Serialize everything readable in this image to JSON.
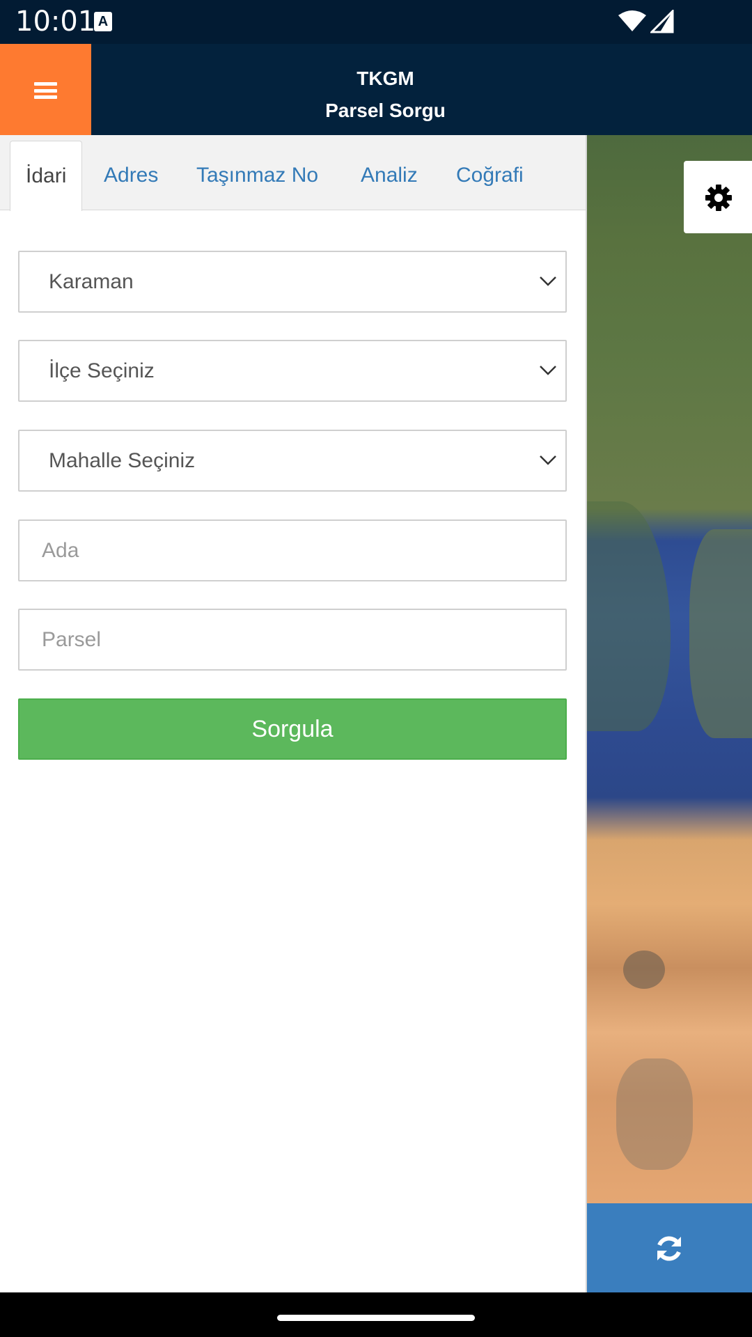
{
  "status_bar": {
    "time": "10:01",
    "notification_icon": "a-icon",
    "wifi_icon": "wifi-icon",
    "signal_icon": "cell-signal-icon"
  },
  "header": {
    "menu_icon": "hamburger-menu-icon",
    "title": "TKGM",
    "subtitle": "Parsel Sorgu",
    "accent_color": "#fe7a30",
    "background_color": "#03223d"
  },
  "tabs": [
    {
      "label": "İdari",
      "active": true
    },
    {
      "label": "Adres",
      "active": false
    },
    {
      "label": "Taşınmaz No",
      "active": false
    },
    {
      "label": "Analiz",
      "active": false
    },
    {
      "label": "Coğrafi",
      "active": false
    }
  ],
  "form": {
    "province_select": {
      "value": "Karaman"
    },
    "district_select": {
      "value": "İlçe Seçiniz"
    },
    "neighborhood_select": {
      "value": "Mahalle Seçiniz"
    },
    "block_input": {
      "placeholder": "Ada",
      "value": ""
    },
    "parcel_input": {
      "placeholder": "Parsel",
      "value": ""
    },
    "submit_label": "Sorgula",
    "submit_color": "#5cb85c"
  },
  "map": {
    "settings_icon": "gear-icon",
    "refresh_icon": "refresh-icon",
    "refresh_color": "#3a7ebe"
  }
}
